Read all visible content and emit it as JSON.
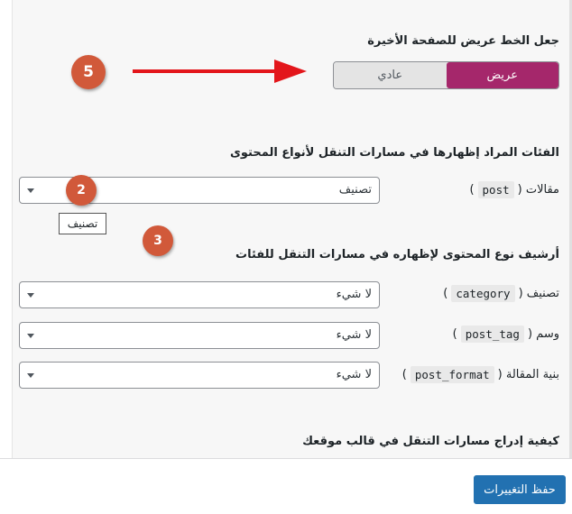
{
  "bold_font_setting": {
    "title": "جعل الخط عريض للصفحة الأخيرة",
    "options": [
      {
        "label": "عريض",
        "selected": true
      },
      {
        "label": "عادي",
        "selected": false
      }
    ]
  },
  "taxonomy_section": {
    "title": "الفئات المراد إظهارها في مسارات التنقل لأنواع المحتوى",
    "rows": [
      {
        "label_prefix": "مقالات (",
        "slug": "post",
        "label_suffix": ")",
        "value": "تصنيف"
      }
    ],
    "tooltip": "تصنيف"
  },
  "archive_section": {
    "title": "أرشيف نوع المحتوى لإظهاره في مسارات التنقل للفئات",
    "rows": [
      {
        "label_prefix": "تصنيف (",
        "slug": "category",
        "label_suffix": ")",
        "value": "لا شيء"
      },
      {
        "label_prefix": "وسم (",
        "slug": "post_tag",
        "label_suffix": ")",
        "value": "لا شيء"
      },
      {
        "label_prefix": "بنية المقالة (",
        "slug": "post_format",
        "label_suffix": ")",
        "value": "لا شيء"
      }
    ]
  },
  "insert_section": {
    "title": "كيفية إدراج مسارات التنقل في قالب موقعك"
  },
  "annotations": {
    "badge_5": "5",
    "badge_2": "2",
    "badge_3": "3",
    "badge_color": "#d1593a",
    "arrow_color": "#e3161b"
  },
  "footer": {
    "save_label": "حفظ التغييرات"
  },
  "colors": {
    "accent_toggle": "#a5276b",
    "primary_button": "#2271b1"
  }
}
